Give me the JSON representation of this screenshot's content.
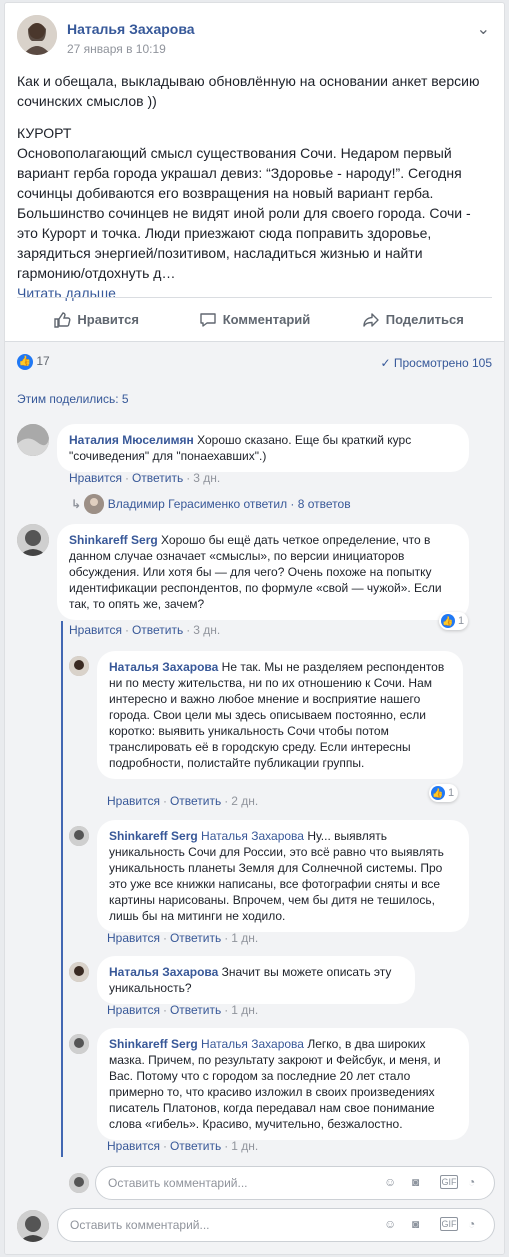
{
  "post": {
    "author": "Наталья Захарова",
    "date": "27 января в 10:19",
    "intro": "Как и обещала, выкладываю обновлённую на основании анкет версию сочинских смыслов ))",
    "section_title": "КУРОРТ",
    "body": "Основополагающий смысл существования Сочи. Недаром первый вариант герба города украшал девиз: “Здоровье - народу!”. Сегодня сочинцы добиваются его возвращения на новый вариант герба. Большинство сочинцев не видят иной роли для своего города. Сочи - это Курорт и точка. Люди приезжают сюда поправить здоровье, зарядиться энергией/позитивом, насладиться жизнью и найти гармонию/отдохнуть д…",
    "read_more": "Читать дальше"
  },
  "actions": {
    "like": "Нравится",
    "comment": "Комментарий",
    "share": "Поделиться"
  },
  "stats": {
    "likes": "17",
    "views": "Просмотрено 105",
    "shares": "Этим поделились: 5"
  },
  "comments": [
    {
      "author": "Наталия Мюселимян",
      "text": "Хорошо сказано. Еще бы краткий курс \"сочиведения\" для \"понаехавших\".)",
      "like": "Нравится",
      "reply": "Ответить",
      "time": "3 дн."
    },
    {
      "replies_summary": "Владимир Герасименко ответил · 8 ответов"
    },
    {
      "author": "Shinkareff Serg",
      "text": "Хорошо бы ещё дать четкое определение, что в данном случае означает «смыслы», по версии инициаторов обсуждения. Или хотя бы — для чего? Очень похоже на попытку идентификации респондентов, по формуле «свой — чужой». Если так, то опять же, зачем?",
      "like": "Нравится",
      "reply": "Ответить",
      "time": "3 дн.",
      "reactions": "1"
    },
    {
      "author": "Наталья Захарова",
      "text": "Не так. Мы не разделяем респондентов ни по месту жительства, ни по их отношению к Сочи. Нам интересно и важно любое мнение и восприятие нашего города. Свои цели мы здесь описываем постоянно, если коротко: выявить уникальность Сочи чтобы потом транслировать её в городскую среду. Если интересны подробности, полистайте публикации группы.",
      "like": "Нравится",
      "reply": "Ответить",
      "time": "2 дн.",
      "reactions": "1"
    },
    {
      "author": "Shinkareff Serg",
      "mention": "Наталья Захарова",
      "text": "Ну... выявлять уникальность Сочи для России, это всё равно что выявлять уникальность планеты Земля для Солнечной системы. Про это уже все книжки написаны, все фотографии сняты и все картины нарисованы. Впрочем, чем бы дитя не тешилось, лишь бы на митинги не ходило.",
      "like": "Нравится",
      "reply": "Ответить",
      "time": "1 дн."
    },
    {
      "author": "Наталья Захарова",
      "text": "Значит вы можете описать эту уникальность?",
      "like": "Нравится",
      "reply": "Ответить",
      "time": "1 дн."
    },
    {
      "author": "Shinkareff Serg",
      "mention": "Наталья Захарова",
      "text": "Легко, в два широких мазка. Причем, по результату закроют и Фейсбук, и меня, и Вас. Потому что с городом за последние 20 лет стало примерно то, что красиво изложил в своих произведениях писатель Платонов, когда передавал нам свое понимание слова «гибель». Красиво, мучительно, безжалостно.",
      "like": "Нравится",
      "reply": "Ответить",
      "time": "1 дн."
    }
  ],
  "composer": {
    "placeholder_reply": "Оставить комментарий...",
    "placeholder_main": "Оставить комментарий..."
  },
  "colors": {
    "link": "#365899",
    "accent": "#4267b2",
    "like_blue": "#2078f4"
  }
}
